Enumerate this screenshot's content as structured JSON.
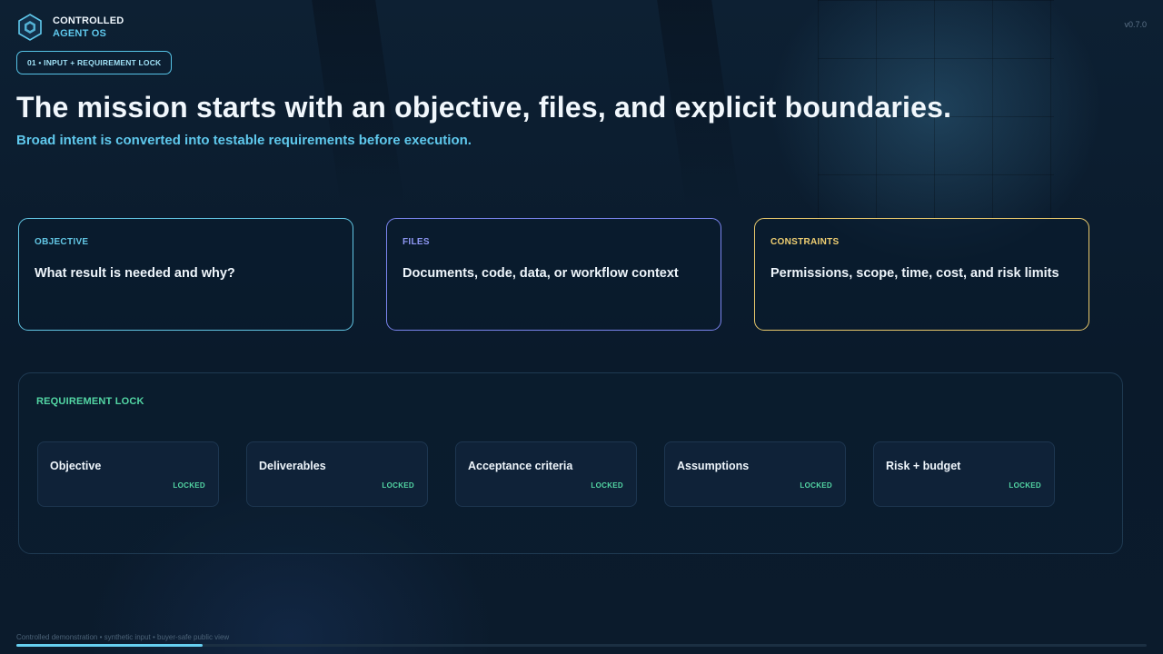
{
  "brand": {
    "line1": "CONTROLLED",
    "line2": "AGENT OS",
    "logo_icon": "hexagon-logo-icon"
  },
  "version": "v0.7.0",
  "step_pill": "01 • INPUT + REQUIREMENT LOCK",
  "headline": "The mission starts with an objective, files, and explicit boundaries.",
  "subheadline": "Broad intent is converted into testable requirements before execution.",
  "cards": [
    {
      "label": "OBJECTIVE",
      "text": "What result is needed and why?",
      "accent": "#62c6e4"
    },
    {
      "label": "FILES",
      "text": "Documents, code, data, or workflow context",
      "accent": "#7a84ee"
    },
    {
      "label": "CONSTRAINTS",
      "text": "Permissions, scope, time, cost, and risk limits",
      "accent": "#e9c96c"
    }
  ],
  "requirement_lock": {
    "title": "REQUIREMENT LOCK",
    "items": [
      {
        "name": "Objective",
        "status": "LOCKED"
      },
      {
        "name": "Deliverables",
        "status": "LOCKED"
      },
      {
        "name": "Acceptance criteria",
        "status": "LOCKED"
      },
      {
        "name": "Assumptions",
        "status": "LOCKED"
      },
      {
        "name": "Risk + budget",
        "status": "LOCKED"
      }
    ],
    "status_color": "#53d6a4"
  },
  "footer": "Controlled demonstration • synthetic input • buyer-safe public view",
  "progress": {
    "value": 0.165,
    "color": "#66cff0"
  }
}
